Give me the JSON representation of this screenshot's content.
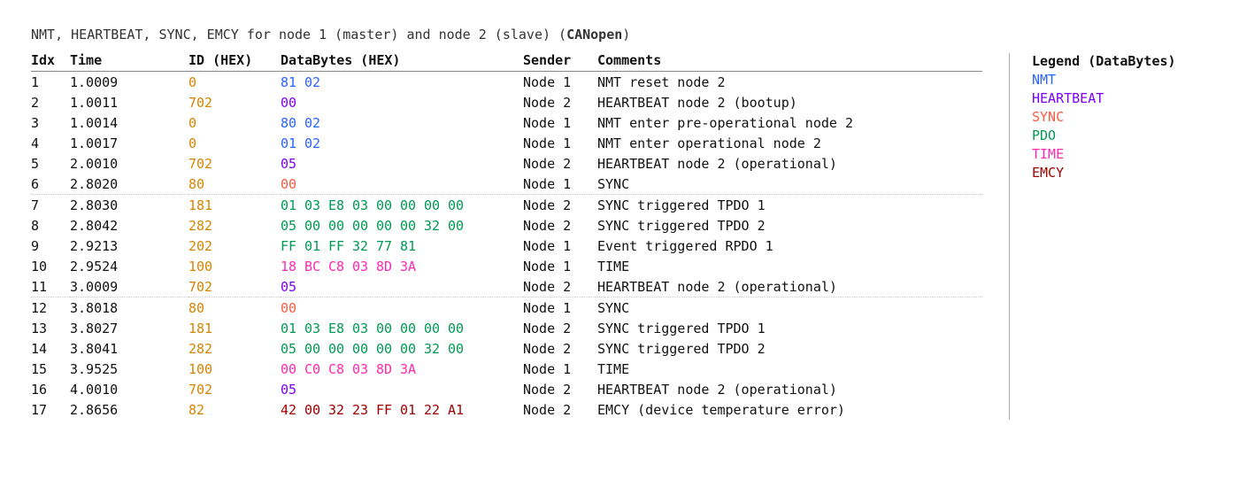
{
  "title": {
    "prefix": "NMT, HEARTBEAT, SYNC, EMCY for node 1 (master) and node 2 (slave) (",
    "strong": "CANopen",
    "suffix": ")"
  },
  "columns": {
    "idx": "Idx",
    "time": "Time",
    "id": "ID (HEX)",
    "databytes": "DataBytes (HEX)",
    "sender": "Sender",
    "comments": "Comments"
  },
  "rows": [
    {
      "idx": "1",
      "time": "1.0009",
      "id": "0",
      "bytes": [
        "81",
        "02"
      ],
      "cls": "nmt",
      "sender": "Node 1",
      "comment": "NMT reset node 2"
    },
    {
      "idx": "2",
      "time": "1.0011",
      "id": "702",
      "bytes": [
        "00"
      ],
      "cls": "hb",
      "sender": "Node 2",
      "comment": "HEARTBEAT node 2 (bootup)"
    },
    {
      "idx": "3",
      "time": "1.0014",
      "id": "0",
      "bytes": [
        "80",
        "02"
      ],
      "cls": "nmt",
      "sender": "Node 1",
      "comment": "NMT enter pre-operational node 2"
    },
    {
      "idx": "4",
      "time": "1.0017",
      "id": "0",
      "bytes": [
        "01",
        "02"
      ],
      "cls": "nmt",
      "sender": "Node 1",
      "comment": "NMT enter operational node 2"
    },
    {
      "idx": "5",
      "time": "2.0010",
      "id": "702",
      "bytes": [
        "05"
      ],
      "cls": "hb",
      "sender": "Node 2",
      "comment": "HEARTBEAT node 2 (operational)"
    },
    {
      "idx": "6",
      "time": "2.8020",
      "id": "80",
      "bytes": [
        "00"
      ],
      "cls": "sync",
      "sender": "Node 1",
      "comment": "SYNC"
    },
    {
      "idx": "7",
      "time": "2.8030",
      "id": "181",
      "bytes": [
        "01",
        "03",
        "E8",
        "03",
        "00",
        "00",
        "00",
        "00"
      ],
      "cls": "pdo",
      "sender": "Node 2",
      "comment": "SYNC triggered TPDO 1"
    },
    {
      "idx": "8",
      "time": "2.8042",
      "id": "282",
      "bytes": [
        "05",
        "00",
        "00",
        "00",
        "00",
        "00",
        "32",
        "00"
      ],
      "cls": "pdo",
      "sender": "Node 2",
      "comment": "SYNC triggered TPDO 2"
    },
    {
      "idx": "9",
      "time": "2.9213",
      "id": "202",
      "bytes": [
        "FF",
        "01",
        "FF",
        "32",
        "77",
        "81"
      ],
      "cls": "pdo",
      "sender": "Node 1",
      "comment": "Event triggered RPDO 1"
    },
    {
      "idx": "10",
      "time": "2.9524",
      "id": "100",
      "bytes": [
        "18",
        "BC",
        "C8",
        "03",
        "8D",
        "3A"
      ],
      "cls": "time",
      "sender": "Node 1",
      "comment": "TIME"
    },
    {
      "idx": "11",
      "time": "3.0009",
      "id": "702",
      "bytes": [
        "05"
      ],
      "cls": "hb",
      "sender": "Node 2",
      "comment": "HEARTBEAT node 2 (operational)"
    },
    {
      "idx": "12",
      "time": "3.8018",
      "id": "80",
      "bytes": [
        "00"
      ],
      "cls": "sync",
      "sender": "Node 1",
      "comment": "SYNC"
    },
    {
      "idx": "13",
      "time": "3.8027",
      "id": "181",
      "bytes": [
        "01",
        "03",
        "E8",
        "03",
        "00",
        "00",
        "00",
        "00"
      ],
      "cls": "pdo",
      "sender": "Node 2",
      "comment": "SYNC triggered TPDO 1"
    },
    {
      "idx": "14",
      "time": "3.8041",
      "id": "282",
      "bytes": [
        "05",
        "00",
        "00",
        "00",
        "00",
        "00",
        "32",
        "00"
      ],
      "cls": "pdo",
      "sender": "Node 2",
      "comment": "SYNC triggered TPDO 2"
    },
    {
      "idx": "15",
      "time": "3.9525",
      "id": "100",
      "bytes": [
        "00",
        "C0",
        "C8",
        "03",
        "8D",
        "3A"
      ],
      "cls": "time",
      "sender": "Node 1",
      "comment": "TIME"
    },
    {
      "idx": "16",
      "time": "4.0010",
      "id": "702",
      "bytes": [
        "05"
      ],
      "cls": "hb",
      "sender": "Node 2",
      "comment": "HEARTBEAT node 2 (operational)"
    },
    {
      "idx": "17",
      "time": "2.8656",
      "id": "82",
      "bytes": [
        "42",
        "00",
        "32",
        "23",
        "FF",
        "01",
        "22",
        "A1"
      ],
      "cls": "emcy",
      "sender": "Node 2",
      "comment": "EMCY (device temperature error)"
    }
  ],
  "legend": {
    "title": "Legend (DataBytes)",
    "items": [
      {
        "label": "NMT",
        "cls": "nmt"
      },
      {
        "label": "HEARTBEAT",
        "cls": "hb"
      },
      {
        "label": "SYNC",
        "cls": "sync"
      },
      {
        "label": "PDO",
        "cls": "pdo"
      },
      {
        "label": "TIME",
        "cls": "time"
      },
      {
        "label": "EMCY",
        "cls": "emcy"
      }
    ]
  }
}
